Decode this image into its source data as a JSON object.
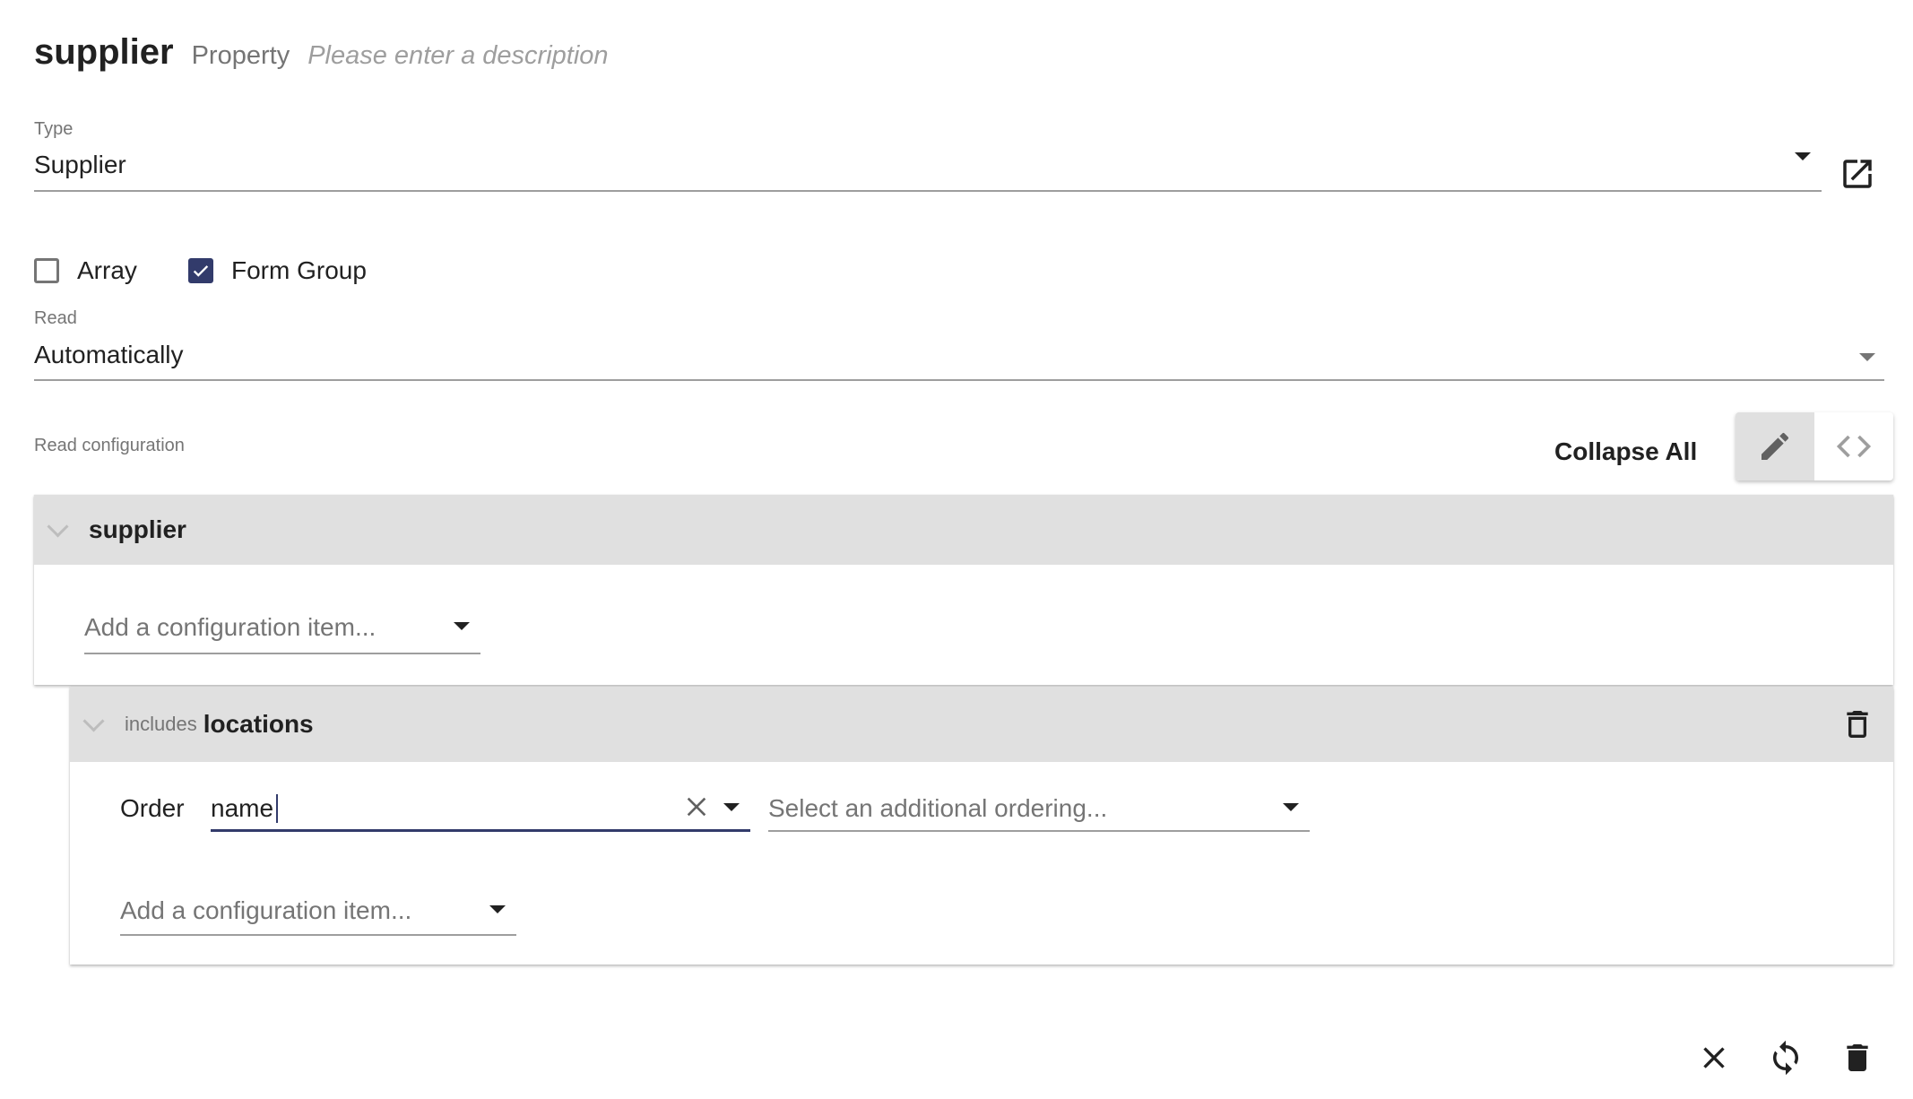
{
  "header": {
    "title": "supplier",
    "kind": "Property",
    "description_placeholder": "Please enter a description"
  },
  "type_field": {
    "label": "Type",
    "value": "Supplier",
    "open_icon": "open-in-new-icon"
  },
  "checkboxes": [
    {
      "label": "Array",
      "checked": false
    },
    {
      "label": "Form Group",
      "checked": true
    }
  ],
  "read_field": {
    "label": "Read",
    "value": "Automatically"
  },
  "read_configuration": {
    "label": "Read configuration",
    "collapse_all_label": "Collapse All",
    "view_toggle": [
      {
        "icon": "pencil-icon",
        "active": true
      },
      {
        "icon": "code-icon",
        "active": false
      }
    ]
  },
  "tree": {
    "root": {
      "name": "supplier",
      "add_item_placeholder": "Add a configuration item..."
    },
    "child": {
      "prefix": "includes",
      "name": "locations",
      "order_label": "Order",
      "order_value": "name",
      "additional_ordering_placeholder": "Select an additional ordering...",
      "add_item_placeholder": "Add a configuration item..."
    }
  },
  "footer_actions": [
    {
      "name": "close",
      "icon": "close-icon"
    },
    {
      "name": "refresh",
      "icon": "refresh-icon"
    },
    {
      "name": "delete",
      "icon": "delete-icon"
    }
  ],
  "colors": {
    "accent": "#323b6b",
    "panel_header": "#e0e0e0"
  }
}
